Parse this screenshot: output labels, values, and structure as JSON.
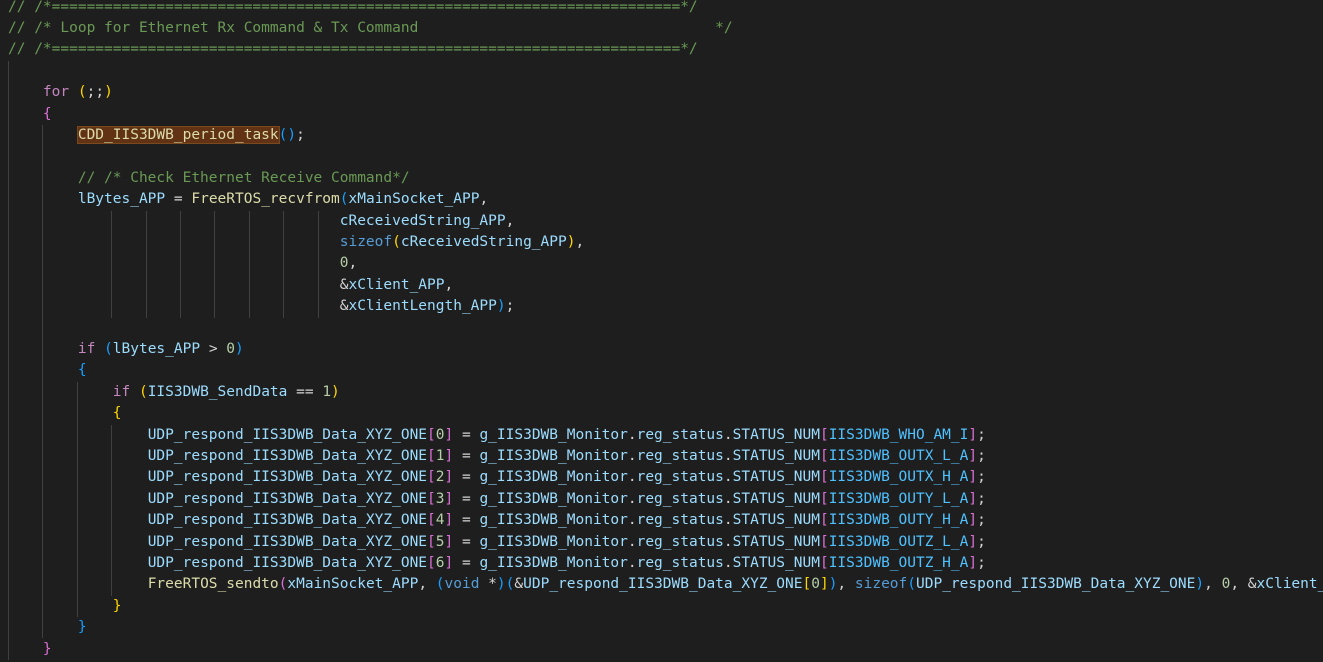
{
  "editor": {
    "lines": [
      {
        "tokens": [
          {
            "t": "// /*========================================================================*/",
            "c": "tok-comment"
          }
        ]
      },
      {
        "tokens": [
          {
            "t": "// /* Loop for Ethernet Rx Command & Tx Command                                  */",
            "c": "tok-comment"
          }
        ]
      },
      {
        "tokens": [
          {
            "t": "// /*========================================================================*/",
            "c": "tok-comment"
          }
        ]
      },
      {
        "tokens": []
      },
      {
        "tokens": [
          {
            "t": "    "
          },
          {
            "t": "for",
            "c": "tok-kw"
          },
          {
            "t": " "
          },
          {
            "t": "(",
            "c": "b1"
          },
          {
            "t": ";;"
          },
          {
            "t": ")",
            "c": "b1"
          }
        ]
      },
      {
        "tokens": [
          {
            "t": "    "
          },
          {
            "t": "{",
            "c": "b2"
          }
        ]
      },
      {
        "tokens": [
          {
            "t": "        "
          },
          {
            "t": "CDD_IIS3DWB_period_task",
            "c": "tok-fn hl"
          },
          {
            "t": "()",
            "c": "b3"
          },
          {
            "t": ";"
          }
        ]
      },
      {
        "tokens": []
      },
      {
        "tokens": [
          {
            "t": "        "
          },
          {
            "t": "// /* Check Ethernet Receive Command*/",
            "c": "tok-comment"
          }
        ]
      },
      {
        "tokens": [
          {
            "t": "        "
          },
          {
            "t": "lBytes_APP",
            "c": "tok-var"
          },
          {
            "t": " = "
          },
          {
            "t": "FreeRTOS_recvfrom",
            "c": "tok-fn"
          },
          {
            "t": "(",
            "c": "b3"
          },
          {
            "t": "xMainSocket_APP",
            "c": "tok-var"
          },
          {
            "t": ","
          }
        ]
      },
      {
        "tokens": [
          {
            "t": "                                      "
          },
          {
            "t": "cReceivedString_APP",
            "c": "tok-var"
          },
          {
            "t": ","
          }
        ]
      },
      {
        "tokens": [
          {
            "t": "                                      "
          },
          {
            "t": "sizeof",
            "c": "tok-type"
          },
          {
            "t": "(",
            "c": "b1"
          },
          {
            "t": "cReceivedString_APP",
            "c": "tok-var"
          },
          {
            "t": ")",
            "c": "b1"
          },
          {
            "t": ","
          }
        ]
      },
      {
        "tokens": [
          {
            "t": "                                      "
          },
          {
            "t": "0",
            "c": "tok-num"
          },
          {
            "t": ","
          }
        ]
      },
      {
        "tokens": [
          {
            "t": "                                      &"
          },
          {
            "t": "xClient_APP",
            "c": "tok-var"
          },
          {
            "t": ","
          }
        ]
      },
      {
        "tokens": [
          {
            "t": "                                      &"
          },
          {
            "t": "xClientLength_APP",
            "c": "tok-var"
          },
          {
            "t": ")",
            "c": "b3"
          },
          {
            "t": ";"
          }
        ]
      },
      {
        "tokens": []
      },
      {
        "tokens": [
          {
            "t": "        "
          },
          {
            "t": "if",
            "c": "tok-kw"
          },
          {
            "t": " "
          },
          {
            "t": "(",
            "c": "b3"
          },
          {
            "t": "lBytes_APP",
            "c": "tok-var"
          },
          {
            "t": " > "
          },
          {
            "t": "0",
            "c": "tok-num"
          },
          {
            "t": ")",
            "c": "b3"
          }
        ]
      },
      {
        "tokens": [
          {
            "t": "        "
          },
          {
            "t": "{",
            "c": "b3"
          }
        ]
      },
      {
        "tokens": [
          {
            "t": "            "
          },
          {
            "t": "if",
            "c": "tok-kw"
          },
          {
            "t": " "
          },
          {
            "t": "(",
            "c": "b1"
          },
          {
            "t": "IIS3DWB_SendData",
            "c": "tok-var"
          },
          {
            "t": " == "
          },
          {
            "t": "1",
            "c": "tok-num"
          },
          {
            "t": ")",
            "c": "b1"
          }
        ]
      },
      {
        "tokens": [
          {
            "t": "            "
          },
          {
            "t": "{",
            "c": "b1"
          }
        ]
      },
      {
        "tokens": [
          {
            "t": "                "
          },
          {
            "t": "UDP_respond_IIS3DWB_Data_XYZ_ONE",
            "c": "tok-var"
          },
          {
            "t": "[",
            "c": "b2"
          },
          {
            "t": "0",
            "c": "tok-num"
          },
          {
            "t": "]",
            "c": "b2"
          },
          {
            "t": " = "
          },
          {
            "t": "g_IIS3DWB_Monitor",
            "c": "tok-var"
          },
          {
            "t": "."
          },
          {
            "t": "reg_status",
            "c": "tok-var"
          },
          {
            "t": "."
          },
          {
            "t": "STATUS_NUM",
            "c": "tok-var"
          },
          {
            "t": "[",
            "c": "b2"
          },
          {
            "t": "IIS3DWB_WHO_AM_I",
            "c": "tok-const"
          },
          {
            "t": "]",
            "c": "b2"
          },
          {
            "t": ";"
          }
        ]
      },
      {
        "tokens": [
          {
            "t": "                "
          },
          {
            "t": "UDP_respond_IIS3DWB_Data_XYZ_ONE",
            "c": "tok-var"
          },
          {
            "t": "[",
            "c": "b2"
          },
          {
            "t": "1",
            "c": "tok-num"
          },
          {
            "t": "]",
            "c": "b2"
          },
          {
            "t": " = "
          },
          {
            "t": "g_IIS3DWB_Monitor",
            "c": "tok-var"
          },
          {
            "t": "."
          },
          {
            "t": "reg_status",
            "c": "tok-var"
          },
          {
            "t": "."
          },
          {
            "t": "STATUS_NUM",
            "c": "tok-var"
          },
          {
            "t": "[",
            "c": "b2"
          },
          {
            "t": "IIS3DWB_OUTX_L_A",
            "c": "tok-const"
          },
          {
            "t": "]",
            "c": "b2"
          },
          {
            "t": ";"
          }
        ]
      },
      {
        "tokens": [
          {
            "t": "                "
          },
          {
            "t": "UDP_respond_IIS3DWB_Data_XYZ_ONE",
            "c": "tok-var"
          },
          {
            "t": "[",
            "c": "b2"
          },
          {
            "t": "2",
            "c": "tok-num"
          },
          {
            "t": "]",
            "c": "b2"
          },
          {
            "t": " = "
          },
          {
            "t": "g_IIS3DWB_Monitor",
            "c": "tok-var"
          },
          {
            "t": "."
          },
          {
            "t": "reg_status",
            "c": "tok-var"
          },
          {
            "t": "."
          },
          {
            "t": "STATUS_NUM",
            "c": "tok-var"
          },
          {
            "t": "[",
            "c": "b2"
          },
          {
            "t": "IIS3DWB_OUTX_H_A",
            "c": "tok-const"
          },
          {
            "t": "]",
            "c": "b2"
          },
          {
            "t": ";"
          }
        ]
      },
      {
        "tokens": [
          {
            "t": "                "
          },
          {
            "t": "UDP_respond_IIS3DWB_Data_XYZ_ONE",
            "c": "tok-var"
          },
          {
            "t": "[",
            "c": "b2"
          },
          {
            "t": "3",
            "c": "tok-num"
          },
          {
            "t": "]",
            "c": "b2"
          },
          {
            "t": " = "
          },
          {
            "t": "g_IIS3DWB_Monitor",
            "c": "tok-var"
          },
          {
            "t": "."
          },
          {
            "t": "reg_status",
            "c": "tok-var"
          },
          {
            "t": "."
          },
          {
            "t": "STATUS_NUM",
            "c": "tok-var"
          },
          {
            "t": "[",
            "c": "b2"
          },
          {
            "t": "IIS3DWB_OUTY_L_A",
            "c": "tok-const"
          },
          {
            "t": "]",
            "c": "b2"
          },
          {
            "t": ";"
          }
        ]
      },
      {
        "tokens": [
          {
            "t": "                "
          },
          {
            "t": "UDP_respond_IIS3DWB_Data_XYZ_ONE",
            "c": "tok-var"
          },
          {
            "t": "[",
            "c": "b2"
          },
          {
            "t": "4",
            "c": "tok-num"
          },
          {
            "t": "]",
            "c": "b2"
          },
          {
            "t": " = "
          },
          {
            "t": "g_IIS3DWB_Monitor",
            "c": "tok-var"
          },
          {
            "t": "."
          },
          {
            "t": "reg_status",
            "c": "tok-var"
          },
          {
            "t": "."
          },
          {
            "t": "STATUS_NUM",
            "c": "tok-var"
          },
          {
            "t": "[",
            "c": "b2"
          },
          {
            "t": "IIS3DWB_OUTY_H_A",
            "c": "tok-const"
          },
          {
            "t": "]",
            "c": "b2"
          },
          {
            "t": ";"
          }
        ]
      },
      {
        "tokens": [
          {
            "t": "                "
          },
          {
            "t": "UDP_respond_IIS3DWB_Data_XYZ_ONE",
            "c": "tok-var"
          },
          {
            "t": "[",
            "c": "b2"
          },
          {
            "t": "5",
            "c": "tok-num"
          },
          {
            "t": "]",
            "c": "b2"
          },
          {
            "t": " = "
          },
          {
            "t": "g_IIS3DWB_Monitor",
            "c": "tok-var"
          },
          {
            "t": "."
          },
          {
            "t": "reg_status",
            "c": "tok-var"
          },
          {
            "t": "."
          },
          {
            "t": "STATUS_NUM",
            "c": "tok-var"
          },
          {
            "t": "[",
            "c": "b2"
          },
          {
            "t": "IIS3DWB_OUTZ_L_A",
            "c": "tok-const"
          },
          {
            "t": "]",
            "c": "b2"
          },
          {
            "t": ";"
          }
        ]
      },
      {
        "tokens": [
          {
            "t": "                "
          },
          {
            "t": "UDP_respond_IIS3DWB_Data_XYZ_ONE",
            "c": "tok-var"
          },
          {
            "t": "[",
            "c": "b2"
          },
          {
            "t": "6",
            "c": "tok-num"
          },
          {
            "t": "]",
            "c": "b2"
          },
          {
            "t": " = "
          },
          {
            "t": "g_IIS3DWB_Monitor",
            "c": "tok-var"
          },
          {
            "t": "."
          },
          {
            "t": "reg_status",
            "c": "tok-var"
          },
          {
            "t": "."
          },
          {
            "t": "STATUS_NUM",
            "c": "tok-var"
          },
          {
            "t": "[",
            "c": "b2"
          },
          {
            "t": "IIS3DWB_OUTZ_H_A",
            "c": "tok-const"
          },
          {
            "t": "]",
            "c": "b2"
          },
          {
            "t": ";"
          }
        ]
      },
      {
        "tokens": [
          {
            "t": "                "
          },
          {
            "t": "FreeRTOS_sendto",
            "c": "tok-fn"
          },
          {
            "t": "(",
            "c": "b2"
          },
          {
            "t": "xMainSocket_APP",
            "c": "tok-var"
          },
          {
            "t": ", "
          },
          {
            "t": "(",
            "c": "b3"
          },
          {
            "t": "void",
            "c": "tok-type"
          },
          {
            "t": " *"
          },
          {
            "t": ")",
            "c": "b3"
          },
          {
            "t": "(",
            "c": "b3"
          },
          {
            "t": "&"
          },
          {
            "t": "UDP_respond_IIS3DWB_Data_XYZ_ONE",
            "c": "tok-var"
          },
          {
            "t": "[",
            "c": "b1"
          },
          {
            "t": "0",
            "c": "tok-num"
          },
          {
            "t": "]",
            "c": "b1"
          },
          {
            "t": ")",
            "c": "b3"
          },
          {
            "t": ", "
          },
          {
            "t": "sizeof",
            "c": "tok-type"
          },
          {
            "t": "(",
            "c": "b3"
          },
          {
            "t": "UDP_respond_IIS3DWB_Data_XYZ_ONE",
            "c": "tok-var"
          },
          {
            "t": ")",
            "c": "b3"
          },
          {
            "t": ", "
          },
          {
            "t": "0",
            "c": "tok-num"
          },
          {
            "t": ", &"
          },
          {
            "t": "xClient_A",
            "c": "tok-var"
          }
        ]
      },
      {
        "tokens": [
          {
            "t": "            "
          },
          {
            "t": "}",
            "c": "b1"
          }
        ]
      },
      {
        "tokens": [
          {
            "t": "        "
          },
          {
            "t": "}",
            "c": "b3"
          }
        ]
      },
      {
        "tokens": [
          {
            "t": "    "
          },
          {
            "t": "}",
            "c": "b2"
          }
        ]
      }
    ]
  }
}
